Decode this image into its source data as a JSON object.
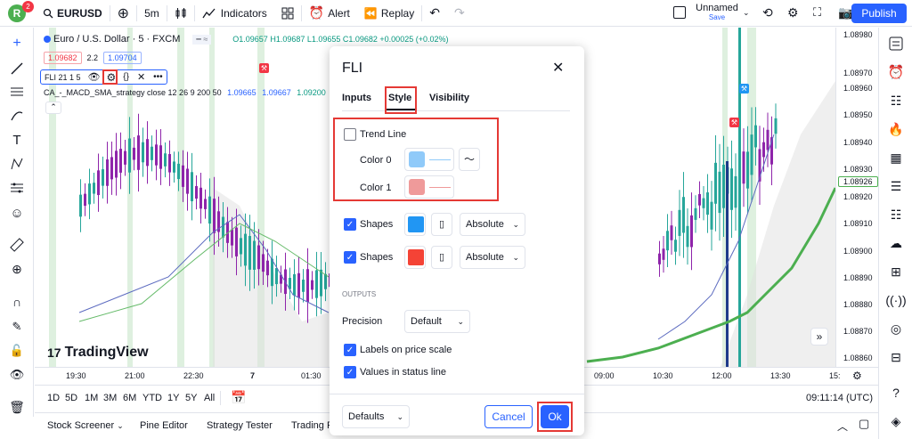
{
  "topbar": {
    "avatar_letter": "R",
    "avatar_badge": "2",
    "symbol": "EURUSD",
    "interval": "5m",
    "indicators": "Indicators",
    "alert": "Alert",
    "replay": "Replay",
    "layout_name": "Unnamed",
    "layout_status": "Save",
    "publish": "Publish"
  },
  "legend": {
    "title": "Euro / U.S. Dollar · 5 · FXCM",
    "ohlc": "O1.09657 H1.09687 L1.09655 C1.09682 +0.00025 (+0.02%)",
    "bid": "1.09682",
    "spread": "2.2",
    "ask": "1.09704",
    "fli_name": "FLI 21 1 5",
    "strategy_name": "CA_-_MACD_SMA_strategy close 12 26 9 200 50",
    "strategy_values": [
      "1.09665",
      "1.09667",
      "1.09200"
    ]
  },
  "watermark": "TradingView",
  "price_axis": {
    "labels": [
      "1.08980",
      "1.08970",
      "1.08960",
      "1.08950",
      "1.08940",
      "1.08930",
      "1.08920",
      "1.08910",
      "1.08900",
      "1.08890",
      "1.08880",
      "1.08870",
      "1.08860"
    ],
    "current": "1.08926"
  },
  "time_axis": [
    "19:30",
    "21:00",
    "22:30",
    "7",
    "01:30",
    "09:00",
    "10:30",
    "12:00",
    "13:30",
    "15:"
  ],
  "range_bar": {
    "ranges": [
      "1D",
      "5D",
      "1M",
      "3M",
      "6M",
      "YTD",
      "1Y",
      "5Y",
      "All"
    ],
    "clock": "09:11:14 (UTC)"
  },
  "bottom_tabs": [
    "Stock Screener",
    "Pine Editor",
    "Strategy Tester",
    "Trading F"
  ],
  "dialog": {
    "title": "FLI",
    "tabs": [
      "Inputs",
      "Style",
      "Visibility"
    ],
    "trend_line": "Trend Line",
    "color0": "Color 0",
    "color1": "Color 1",
    "shapes1_label": "Shapes",
    "shapes1_select": "Absolute",
    "shapes2_label": "Shapes",
    "shapes2_select": "Absolute",
    "outputs_header": "OUTPUTS",
    "precision_label": "Precision",
    "precision_value": "Default",
    "labels_price_scale": "Labels on price scale",
    "values_status_line": "Values in status line",
    "defaults": "Defaults",
    "cancel": "Cancel",
    "ok": "Ok"
  },
  "colors": {
    "accent": "#2962ff",
    "up": "#089981",
    "down": "#f23645",
    "highlight": "#e53935",
    "color0_swatch": "#90caf9",
    "color1_swatch": "#ef9a9a",
    "shapes1_swatch": "#2196f3",
    "shapes2_swatch": "#f44336"
  }
}
